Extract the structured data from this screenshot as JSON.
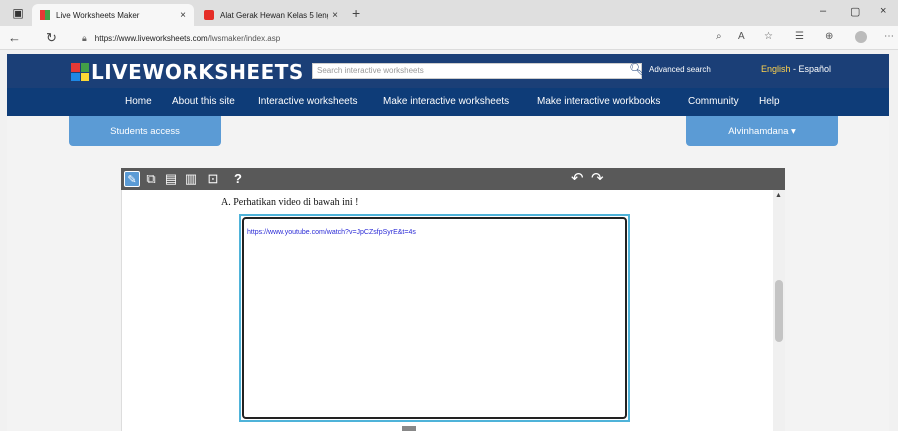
{
  "browser": {
    "tabs": [
      {
        "title": "Live Worksheets Maker",
        "close": "×"
      },
      {
        "title": "Alat Gerak Hewan Kelas 5 lengkap",
        "close": "×"
      }
    ],
    "new_tab": "+",
    "window_controls": {
      "minimize": "–",
      "restore": "▢",
      "close": "×"
    },
    "nav": {
      "back": "←",
      "reload": "↻"
    },
    "url_host": "https://www.liveworksheets.com",
    "url_path": "/lwsmaker/index.asp"
  },
  "site": {
    "logo_text": "LIVEWORKSHEETS",
    "logo_colors": [
      "#e53935",
      "#43a047",
      "#1e88e5",
      "#fdd835"
    ],
    "search_placeholder": "Search interactive worksheets",
    "advanced_search": "Advanced search",
    "lang_en": "English",
    "lang_sep": " - ",
    "lang_es": "Español",
    "nav": [
      "Home",
      "About this site",
      "Interactive worksheets",
      "Make interactive worksheets",
      "Make interactive workbooks",
      "Community",
      "Help"
    ],
    "students_access": "Students access",
    "user_menu": "Alvinhamdana ▾"
  },
  "editor": {
    "toolbar_help": "?",
    "undo": "↶",
    "redo": "↷",
    "question": "A.   Perhatikan video di bawah ini !",
    "textbox_value": "https://www.youtube.com/watch?v=JpCZsfpSyrE&t=4s"
  },
  "colors": {
    "header_bg": "#1b3f77",
    "accent_blue": "#5b9bd5",
    "toolbar_bg": "#595959"
  }
}
